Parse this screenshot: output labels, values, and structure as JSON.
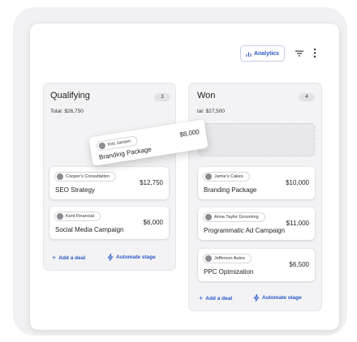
{
  "toolbar": {
    "analytics_label": "Analytics",
    "icons": [
      "bar-chart-icon",
      "filter-icon",
      "more-vertical-icon"
    ]
  },
  "columns": {
    "qualifying": {
      "title": "Qualifying",
      "count": "3",
      "total": "Total: $26,750",
      "deals": [
        {
          "company": "Cooper's Consultation",
          "name": "SEO Strategy",
          "amount": "$12,750"
        },
        {
          "company": "Kent Financial",
          "name": "Social Media Campaign",
          "amount": "$6,000"
        }
      ],
      "add_label": "Add a deal",
      "automate_label": "Automate stage"
    },
    "won": {
      "title": "Won",
      "count": "4",
      "total": "tal: $27,500",
      "deals": [
        {
          "company": "Jamie's Cakes",
          "name": "Branding Package",
          "amount": "$10,000"
        },
        {
          "company": "Anna Taylor Grooming",
          "name": "Programmatic Ad Campaign",
          "amount": "$11,000"
        },
        {
          "company": "Jefferson Autos",
          "name": "PPC Optmization",
          "amount": "$6,500"
        }
      ],
      "add_label": "Add a deal",
      "automate_label": "Automate stage"
    }
  },
  "dragging_deal": {
    "company": "Kris Jansen",
    "name": "Branding Package",
    "amount": "$8,000"
  },
  "colors": {
    "accent": "#2a56c6",
    "column_bg": "#f3f3f5",
    "outer_bg": "#f1f1f3"
  }
}
